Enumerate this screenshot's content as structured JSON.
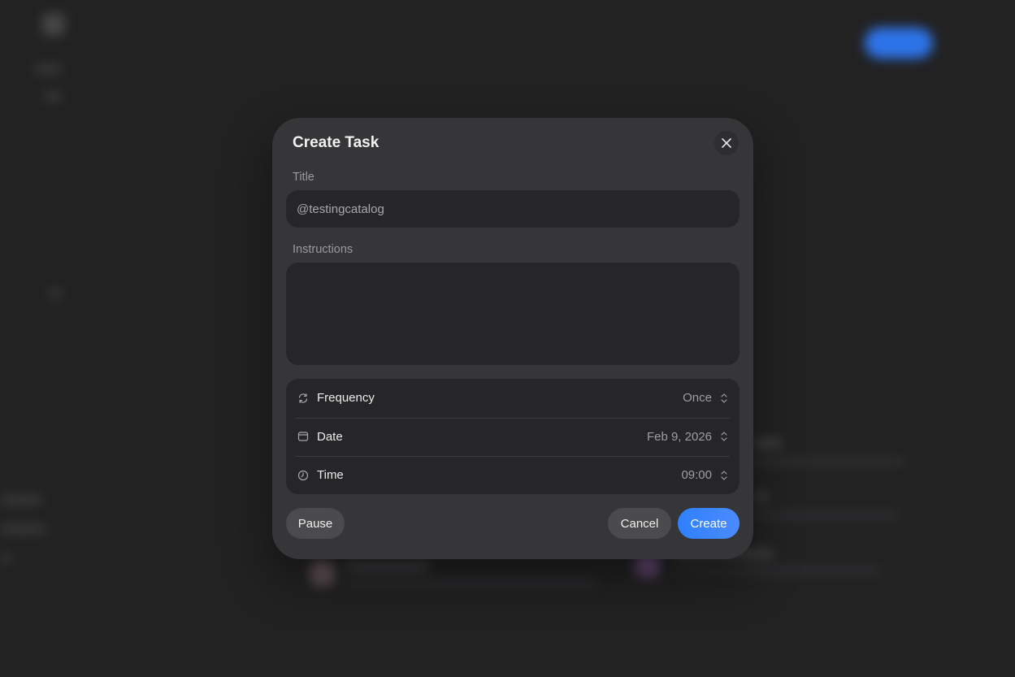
{
  "dialog": {
    "title": "Create Task",
    "title_field": {
      "label": "Title",
      "value": "@testingcatalog"
    },
    "instructions_field": {
      "label": "Instructions",
      "value": ""
    },
    "settings": [
      {
        "label": "Frequency",
        "value": "Once",
        "icon": "repeat-icon"
      },
      {
        "label": "Date",
        "value": "Feb 9, 2026",
        "icon": "calendar-icon"
      },
      {
        "label": "Time",
        "value": "09:00",
        "icon": "clock-icon"
      }
    ],
    "buttons": {
      "pause": "Pause",
      "cancel": "Cancel",
      "create": "Create"
    }
  },
  "colors": {
    "accent": "#2f80ff",
    "modal_bg": "#363638",
    "field_bg": "#262628",
    "page_bg": "#222223"
  }
}
